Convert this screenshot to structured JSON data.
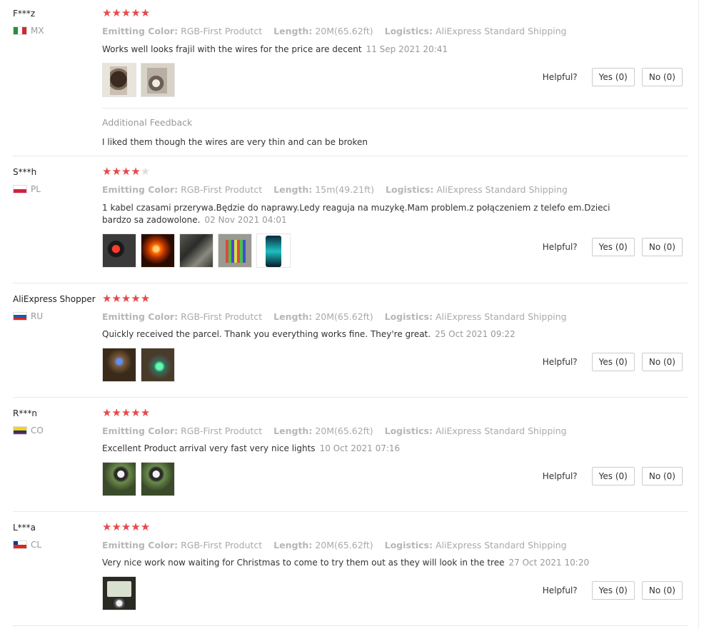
{
  "labels": {
    "attr_color": "Emitting Color:",
    "attr_length": "Length:",
    "attr_logistics": "Logistics:",
    "helpful": "Helpful?",
    "additional_title": "Additional Feedback"
  },
  "colors": {
    "star_on": "#e8484b",
    "star_off": "#dddddd"
  },
  "reviews": [
    {
      "username": "F***z",
      "country": "MX",
      "flag_icon": "mexico-flag-icon",
      "rating": 5,
      "emitting_color": "RGB-First Produtct",
      "length": "20M(65.62ft)",
      "logistics": "AliExpress Standard Shipping",
      "text": "Works well looks frajil with the wires for the price are decent",
      "date": "11 Sep 2021 20:41",
      "photos": 2,
      "yes": "Yes (0)",
      "no": "No (0)",
      "additional_text": "I liked them though the wires are very thin and can be broken"
    },
    {
      "username": "S***h",
      "country": "PL",
      "flag_icon": "poland-flag-icon",
      "rating": 4,
      "emitting_color": "RGB-First Produtct",
      "length": "15m(49.21ft)",
      "logistics": "AliExpress Standard Shipping",
      "text": "1 kabel czasami przerywa.Będzie do naprawy.Ledy reaguja na muzykę.Mam problem.z połączeniem z telefo em.Dzieci bardzo sa zadowolone.",
      "date": "02 Nov 2021 04:01",
      "photos": 5,
      "yes": "Yes (0)",
      "no": "No (0)"
    },
    {
      "username": "AliExpress Shopper",
      "country": "RU",
      "flag_icon": "russia-flag-icon",
      "rating": 5,
      "emitting_color": "RGB-First Produtct",
      "length": "20M(65.62ft)",
      "logistics": "AliExpress Standard Shipping",
      "text": "Quickly received the parcel. Thank you everything works fine. They're great.",
      "date": "25 Oct 2021 09:22",
      "photos": 2,
      "yes": "Yes (0)",
      "no": "No (0)"
    },
    {
      "username": "R***n",
      "country": "CO",
      "flag_icon": "colombia-flag-icon",
      "rating": 5,
      "emitting_color": "RGB-First Produtct",
      "length": "20M(65.62ft)",
      "logistics": "AliExpress Standard Shipping",
      "text": "Excellent Product arrival very fast very nice lights",
      "date": "10 Oct 2021 07:16",
      "photos": 2,
      "yes": "Yes (0)",
      "no": "No (0)"
    },
    {
      "username": "L***a",
      "country": "CL",
      "flag_icon": "chile-flag-icon",
      "rating": 5,
      "emitting_color": "RGB-First Produtct",
      "length": "20M(65.62ft)",
      "logistics": "AliExpress Standard Shipping",
      "text": "Very nice work now waiting for Christmas to come to try them out as they will look in the tree",
      "date": "27 Oct 2021 10:20",
      "photos": 1,
      "yes": "Yes (0)",
      "no": "No (0)"
    }
  ]
}
